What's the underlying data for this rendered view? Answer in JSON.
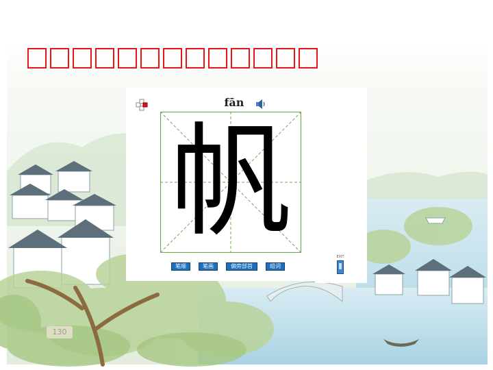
{
  "title": {
    "placeholder_count": 13,
    "color": "#e8141a"
  },
  "character": {
    "hanzi": "帆",
    "pinyin": "fān"
  },
  "toolbar": {
    "buttons": [
      "笔顺",
      "笔画",
      "偏旁部首",
      "组词"
    ]
  },
  "exit": {
    "label": "EXIT"
  },
  "page_number": "130",
  "colors": {
    "grid_border": "#6aa84f",
    "grid_guides": "#6aa84f",
    "button": "#1f6fb8"
  },
  "icons": [
    "control-icon",
    "speaker-icon",
    "exit-icon"
  ]
}
